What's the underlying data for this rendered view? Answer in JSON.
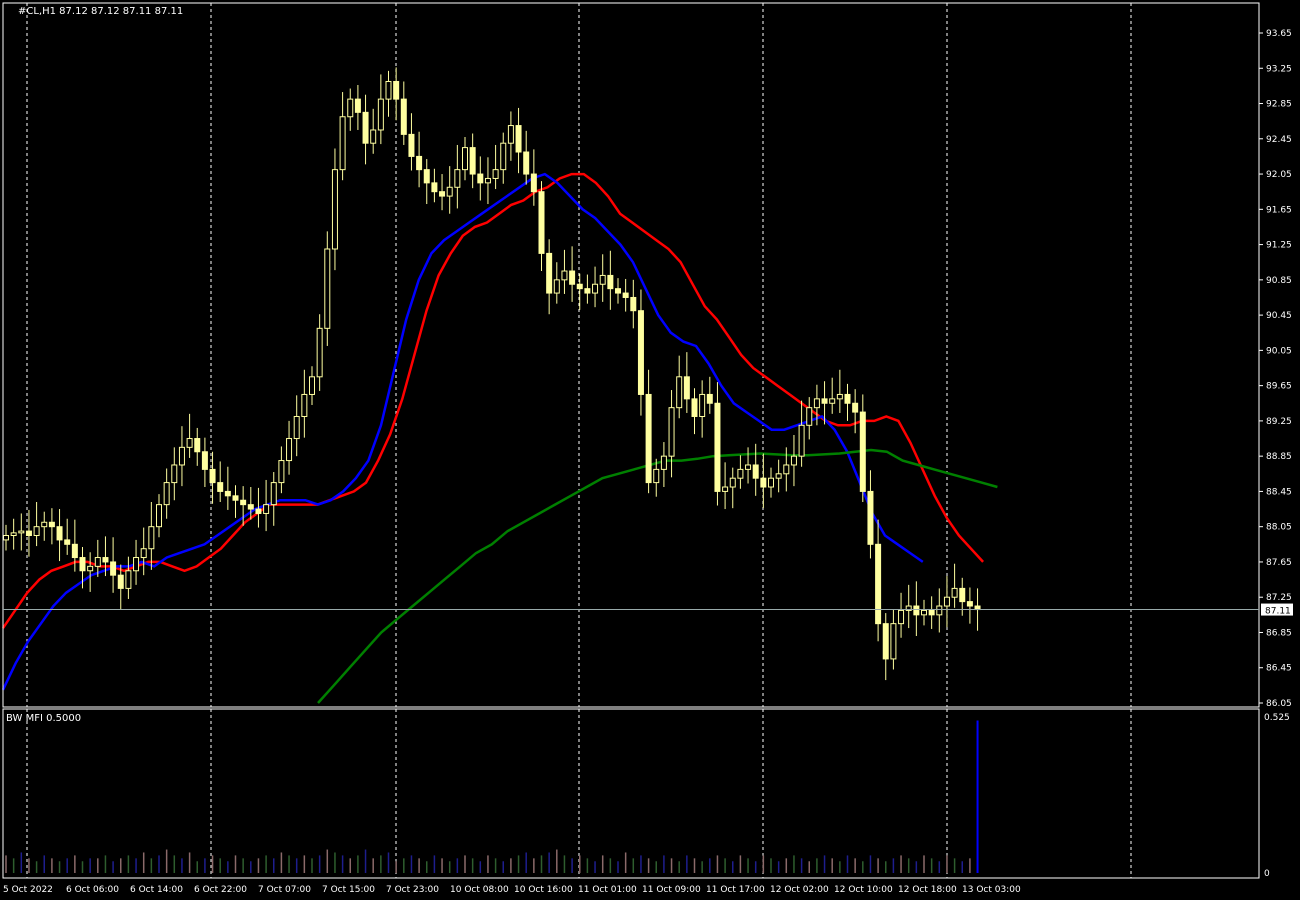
{
  "header": {
    "symbol_info": "#CL,H1  87.12 87.12 87.11 87.11"
  },
  "indicator": {
    "label": "BW MFI 0.5000"
  },
  "colors": {
    "background": "#000000",
    "candle": "#FFFFA0",
    "ma_red": "#FF0000",
    "ma_blue": "#0000FF",
    "ma_green": "#008000",
    "grid": "#FFFFFF",
    "axis_text": "#FFFFFF",
    "mfi_colors": [
      "#8B6A6A",
      "#2E5E2E",
      "#1E1E8E",
      "#0000FF"
    ]
  },
  "chart_data": {
    "type": "candlestick",
    "price_axis": {
      "min": 86.05,
      "max": 93.65,
      "ticks": [
        "93.65",
        "93.25",
        "92.85",
        "92.45",
        "92.05",
        "91.65",
        "91.25",
        "90.85",
        "90.45",
        "90.05",
        "89.65",
        "89.25",
        "88.85",
        "88.45",
        "88.05",
        "87.65",
        "87.25",
        "86.85",
        "86.45",
        "86.05"
      ],
      "current_price": "87.11"
    },
    "time_axis": {
      "labels": [
        "5 Oct 2022",
        "6 Oct 06:00",
        "6 Oct 14:00",
        "6 Oct 22:00",
        "7 Oct 07:00",
        "7 Oct 15:00",
        "7 Oct 23:00",
        "10 Oct 08:00",
        "10 Oct 16:00",
        "11 Oct 01:00",
        "11 Oct 09:00",
        "11 Oct 17:00",
        "12 Oct 02:00",
        "12 Oct 10:00",
        "12 Oct 18:00",
        "13 Oct 03:00"
      ]
    },
    "candle_spacing_bars": 1,
    "close_series": [
      87.95,
      87.98,
      88.0,
      87.95,
      88.05,
      88.1,
      88.05,
      87.9,
      87.85,
      87.7,
      87.55,
      87.6,
      87.7,
      87.65,
      87.5,
      87.35,
      87.55,
      87.7,
      87.8,
      88.05,
      88.3,
      88.55,
      88.75,
      88.95,
      89.05,
      88.9,
      88.7,
      88.55,
      88.45,
      88.4,
      88.35,
      88.3,
      88.25,
      88.2,
      88.3,
      88.55,
      88.8,
      89.05,
      89.3,
      89.55,
      89.75,
      90.3,
      91.2,
      92.1,
      92.7,
      92.9,
      92.75,
      92.4,
      92.55,
      92.9,
      93.1,
      92.9,
      92.5,
      92.25,
      92.1,
      91.95,
      91.85,
      91.8,
      91.9,
      92.1,
      92.35,
      92.05,
      91.95,
      92.0,
      92.1,
      92.4,
      92.6,
      92.3,
      92.05,
      91.85,
      91.15,
      90.7,
      90.85,
      90.95,
      90.8,
      90.75,
      90.7,
      90.8,
      90.9,
      90.75,
      90.7,
      90.65,
      90.5,
      89.55,
      88.55,
      88.7,
      88.85,
      89.4,
      89.75,
      89.5,
      89.3,
      89.55,
      89.45,
      88.45,
      88.5,
      88.6,
      88.7,
      88.75,
      88.6,
      88.5,
      88.6,
      88.65,
      88.75,
      88.85,
      89.2,
      89.4,
      89.5,
      89.45,
      89.5,
      89.55,
      89.45,
      89.35,
      88.45,
      87.85,
      86.95,
      86.55,
      86.95,
      87.1,
      87.15,
      87.05,
      87.1,
      87.05,
      87.15,
      87.25,
      87.35,
      87.2,
      87.15,
      87.11
    ],
    "mfi_values": [
      0.06,
      0.05,
      0.07,
      0.05,
      0.04,
      0.06,
      0.05,
      0.04,
      0.05,
      0.06,
      0.04,
      0.05,
      0.05,
      0.06,
      0.04,
      0.05,
      0.06,
      0.05,
      0.07,
      0.05,
      0.06,
      0.08,
      0.06,
      0.05,
      0.07,
      0.04,
      0.05,
      0.06,
      0.05,
      0.04,
      0.06,
      0.05,
      0.04,
      0.05,
      0.06,
      0.05,
      0.07,
      0.06,
      0.05,
      0.06,
      0.05,
      0.06,
      0.08,
      0.07,
      0.06,
      0.05,
      0.06,
      0.08,
      0.05,
      0.06,
      0.07,
      0.04,
      0.05,
      0.06,
      0.05,
      0.04,
      0.06,
      0.05,
      0.04,
      0.05,
      0.06,
      0.05,
      0.04,
      0.06,
      0.05,
      0.04,
      0.05,
      0.06,
      0.07,
      0.05,
      0.06,
      0.07,
      0.08,
      0.06,
      0.05,
      0.06,
      0.05,
      0.04,
      0.06,
      0.05,
      0.04,
      0.07,
      0.05,
      0.06,
      0.05,
      0.04,
      0.06,
      0.05,
      0.04,
      0.06,
      0.05,
      0.04,
      0.05,
      0.06,
      0.05,
      0.04,
      0.06,
      0.05,
      0.04,
      0.06,
      0.05,
      0.04,
      0.05,
      0.06,
      0.05,
      0.04,
      0.05,
      0.06,
      0.05,
      0.04,
      0.06,
      0.05,
      0.04,
      0.06,
      0.05,
      0.04,
      0.05,
      0.06,
      0.05,
      0.04,
      0.06,
      0.05,
      0.04,
      0.06,
      0.05,
      0.04,
      0.05,
      0.52
    ],
    "mfi_axis": {
      "max_label": "0.525",
      "min_label": "0"
    },
    "moving_averages": [
      {
        "color": "red",
        "values": [
          86.9,
          87.1,
          87.3,
          87.45,
          87.55,
          87.6,
          87.65,
          87.65,
          87.6,
          87.6,
          87.55,
          87.6,
          87.65,
          87.65,
          87.6,
          87.55,
          87.6,
          87.7,
          87.8,
          87.95,
          88.1,
          88.2,
          88.3,
          88.3,
          88.3,
          88.3,
          88.3,
          88.35,
          88.4,
          88.45,
          88.55,
          88.8,
          89.1,
          89.5,
          90.0,
          90.5,
          90.9,
          91.15,
          91.35,
          91.45,
          91.5,
          91.6,
          91.7,
          91.75,
          91.85,
          91.9,
          92.0,
          92.05,
          92.05,
          91.95,
          91.8,
          91.6,
          91.5,
          91.4,
          91.3,
          91.2,
          91.05,
          90.8,
          90.55,
          90.4,
          90.2,
          90.0,
          89.85,
          89.75,
          89.65,
          89.55,
          89.45,
          89.35,
          89.25,
          89.2,
          89.2,
          89.25,
          89.25,
          89.3,
          89.25,
          89.0,
          88.7,
          88.4,
          88.15,
          87.95,
          87.8,
          87.65
        ]
      },
      {
        "color": "blue",
        "values": [
          86.2,
          86.5,
          86.75,
          86.95,
          87.15,
          87.3,
          87.4,
          87.5,
          87.55,
          87.6,
          87.6,
          87.65,
          87.6,
          87.7,
          87.75,
          87.8,
          87.85,
          87.95,
          88.05,
          88.15,
          88.25,
          88.3,
          88.35,
          88.35,
          88.35,
          88.3,
          88.35,
          88.45,
          88.6,
          88.8,
          89.2,
          89.8,
          90.4,
          90.85,
          91.15,
          91.3,
          91.4,
          91.5,
          91.6,
          91.7,
          91.8,
          91.9,
          92.0,
          92.05,
          91.95,
          91.8,
          91.65,
          91.55,
          91.4,
          91.25,
          91.05,
          90.75,
          90.45,
          90.25,
          90.15,
          90.1,
          89.9,
          89.65,
          89.45,
          89.35,
          89.25,
          89.15,
          89.15,
          89.2,
          89.25,
          89.3,
          89.15,
          88.9,
          88.55,
          88.2,
          87.95,
          87.85,
          87.75,
          87.65
        ]
      },
      {
        "color": "green",
        "values": [
          86.05,
          86.25,
          86.45,
          86.65,
          86.85,
          87.0,
          87.15,
          87.3,
          87.45,
          87.6,
          87.75,
          87.85,
          88.0,
          88.1,
          88.2,
          88.3,
          88.4,
          88.5,
          88.6,
          88.65,
          88.7,
          88.75,
          88.8,
          88.8,
          88.82,
          88.85,
          88.86,
          88.87,
          88.88,
          88.87,
          88.86,
          88.86,
          88.87,
          88.88,
          88.9,
          88.92,
          88.9,
          88.8,
          88.75,
          88.7,
          88.65,
          88.6,
          88.55,
          88.5
        ]
      }
    ]
  }
}
